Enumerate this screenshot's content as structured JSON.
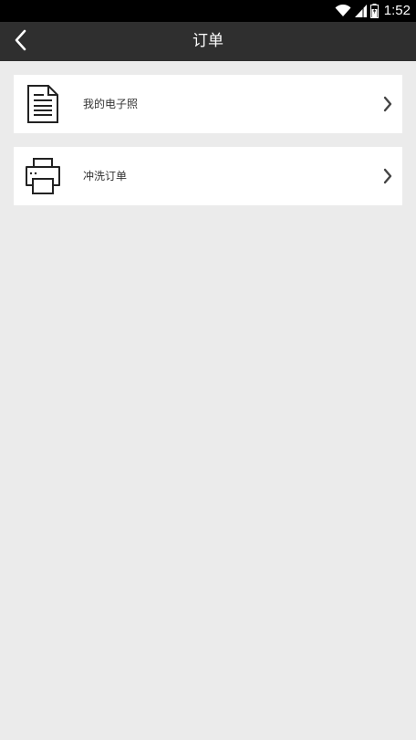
{
  "status_bar": {
    "time": "1:52",
    "icons": [
      "wifi-icon",
      "signal-icon",
      "battery-icon"
    ]
  },
  "app_bar": {
    "title": "订单",
    "back_icon": "back-arrow-icon"
  },
  "list": {
    "items": [
      {
        "label": "我的电子照",
        "icon": "document-icon"
      },
      {
        "label": "冲洗订单",
        "icon": "printer-icon"
      }
    ]
  },
  "colors": {
    "status_bar": "#000000",
    "app_bar": "#2f2f2f",
    "background": "#ebebeb",
    "card": "#ffffff",
    "text": "#333333"
  }
}
